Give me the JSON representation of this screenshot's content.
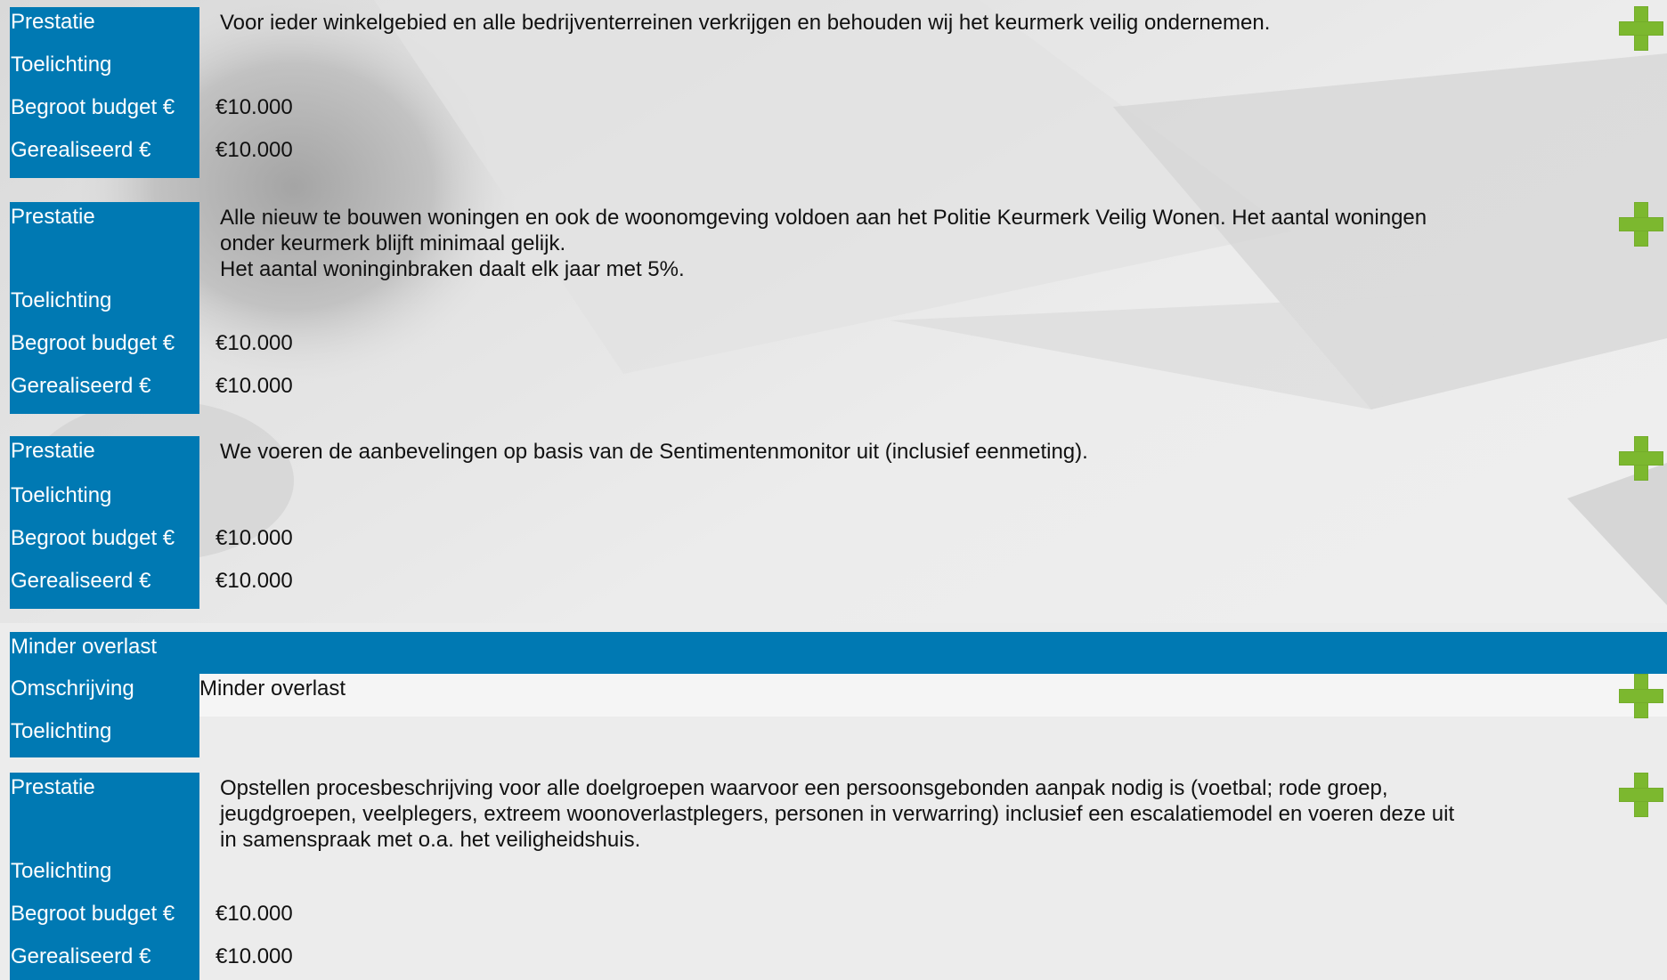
{
  "labels": {
    "prestatie": "Prestatie",
    "toelichting": "Toelichting",
    "begroot": "Begroot budget €",
    "gerealiseerd": "Gerealiseerd €",
    "omschrijving": "Omschrijving"
  },
  "blocks": [
    {
      "prestatie_lines": [
        "Voor ieder winkelgebied en alle bedrijventerreinen verkrijgen en behouden wij het keurmerk veilig ondernemen."
      ],
      "begroot": "€10.000",
      "gerealiseerd": "€10.000"
    },
    {
      "prestatie_lines": [
        "Alle nieuw te bouwen woningen en ook de woonomgeving voldoen aan het Politie Keurmerk Veilig Wonen. Het aantal woningen",
        "onder keurmerk blijft minimaal gelijk.",
        "Het aantal woninginbraken daalt elk jaar met 5%."
      ],
      "begroot": "€10.000",
      "gerealiseerd": "€10.000"
    },
    {
      "prestatie_lines": [
        "We voeren de aanbevelingen op basis van de Sentimentenmonitor uit (inclusief eenmeting)."
      ],
      "begroot": "€10.000",
      "gerealiseerd": "€10.000"
    }
  ],
  "section": {
    "title": "Minder overlast",
    "omschrijving": "Minder overlast"
  },
  "block4": {
    "prestatie_lines": [
      "Opstellen procesbeschrijving voor alle doelgroepen waarvoor een persoonsgebonden aanpak nodig is (voetbal; rode groep,",
      "jeugdgroepen, veelplegers, extreem woonoverlastplegers, personen in verwarring) inclusief een escalatiemodel en voeren deze uit",
      "in samenspraak met o.a. het veiligheidshuis."
    ],
    "begroot": "€10.000",
    "gerealiseerd": "€10.000"
  },
  "icons": {
    "expand": "plus-icon",
    "accent": "#0079b3",
    "plus_color": "#7cb82f"
  }
}
